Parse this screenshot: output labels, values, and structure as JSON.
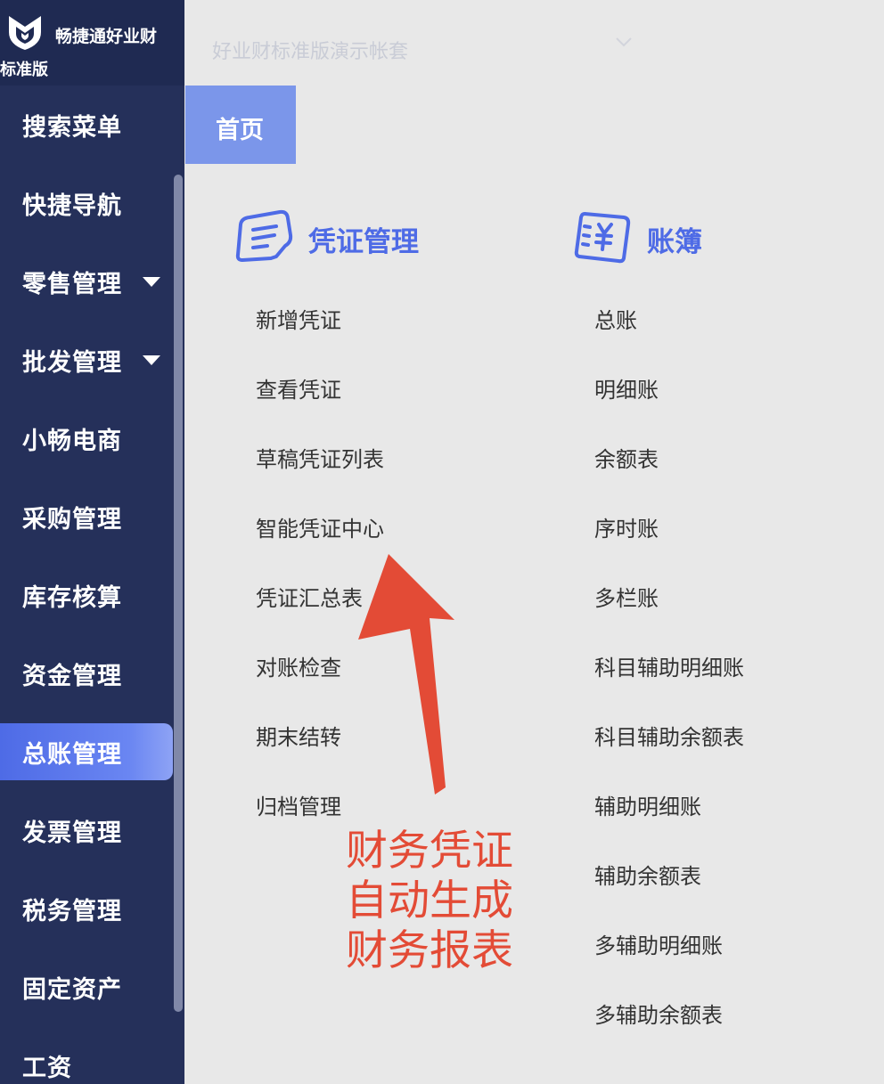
{
  "brand": {
    "name": "畅捷通好业财",
    "edition": "标准版",
    "logo_icon": "brand-logo-icon"
  },
  "account": {
    "selected": "好业财标准版演示帐套",
    "chevron_icon": "chevron-down-icon"
  },
  "sidebar": {
    "items": [
      {
        "label": "搜索菜单",
        "has_submenu": false,
        "active": false
      },
      {
        "label": "快捷导航",
        "has_submenu": false,
        "active": false
      },
      {
        "label": "零售管理",
        "has_submenu": true,
        "active": false
      },
      {
        "label": "批发管理",
        "has_submenu": true,
        "active": false
      },
      {
        "label": "小畅电商",
        "has_submenu": false,
        "active": false
      },
      {
        "label": "采购管理",
        "has_submenu": false,
        "active": false
      },
      {
        "label": "库存核算",
        "has_submenu": false,
        "active": false
      },
      {
        "label": "资金管理",
        "has_submenu": false,
        "active": false
      },
      {
        "label": "总账管理",
        "has_submenu": false,
        "active": true
      },
      {
        "label": "发票管理",
        "has_submenu": false,
        "active": false
      },
      {
        "label": "税务管理",
        "has_submenu": false,
        "active": false
      },
      {
        "label": "固定资产",
        "has_submenu": false,
        "active": false
      },
      {
        "label": "工资",
        "has_submenu": false,
        "active": false
      }
    ]
  },
  "tabs": [
    {
      "label": "首页",
      "active": true
    }
  ],
  "sections": {
    "voucher": {
      "title": "凭证管理",
      "icon": "voucher-icon",
      "links": [
        "新增凭证",
        "查看凭证",
        "草稿凭证列表",
        "智能凭证中心",
        "凭证汇总表",
        "对账检查",
        "期末结转",
        "归档管理"
      ]
    },
    "ledger": {
      "title": "账簿",
      "icon": "ledger-icon",
      "links": [
        "总账",
        "明细账",
        "余额表",
        "序时账",
        "多栏账",
        "科目辅助明细账",
        "科目辅助余额表",
        "辅助明细账",
        "辅助余额表",
        "多辅助明细账",
        "多辅助余额表"
      ]
    }
  },
  "annotation": {
    "lines": [
      "财务凭证",
      "自动生成",
      "财务报表"
    ],
    "color": "#e34b36"
  },
  "colors": {
    "sidebar_bg": "#25305a",
    "accent": "#4e6be6",
    "tab_bg": "#7b96ea",
    "main_bg": "#e8e8e8"
  }
}
